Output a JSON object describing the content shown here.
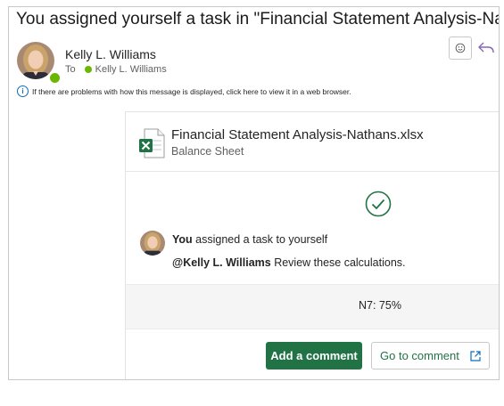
{
  "email": {
    "subject": "You assigned yourself a task in \"Financial Statement Analysis-Nathans\"",
    "sender_name": "Kelly L. Williams",
    "to_label": "To",
    "to_recipient": "Kelly L. Williams",
    "info_text": "If there are problems with how this message is displayed, click here to view it in a web browser.",
    "emoji_icon": "smiley-icon",
    "reply_icon": "reply-icon"
  },
  "card": {
    "file_name": "Financial Statement Analysis-Nathans.xlsx",
    "sheet_name": "Balance Sheet",
    "activity_actor": "You",
    "activity_text": " assigned a task to yourself",
    "mention": "@Kelly L. Williams",
    "comment_text": " Review these calculations.",
    "cell_reference": "N7: 75%",
    "add_comment_label": "Add a comment",
    "go_to_comment_label": "Go to comment"
  },
  "colors": {
    "excel_green": "#217346",
    "presence_green": "#6bb700",
    "info_blue": "#0f6cbd"
  }
}
